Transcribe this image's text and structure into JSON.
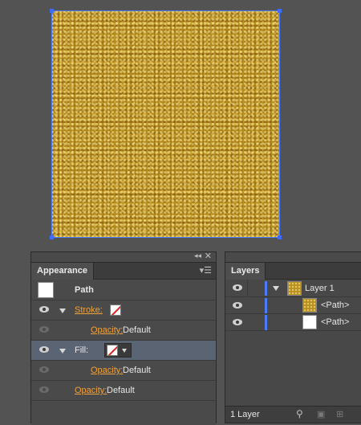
{
  "appearance": {
    "tab_label": "Appearance",
    "object_label": "Path",
    "stroke_label": "Stroke:",
    "fill_label": "Fill:",
    "opacity_label": "Opacity:",
    "opacity_value": "Default"
  },
  "layers": {
    "tab_label": "Layers",
    "layer_name": "Layer 1",
    "items": [
      {
        "label": "<Path>",
        "thumb": "gold"
      },
      {
        "label": "<Path>",
        "thumb": "white"
      }
    ],
    "footer_count": "1 Layer"
  },
  "colors": {
    "selection": "#3d6cff",
    "accent_orange": "#f0a23c",
    "layer_color_bar": "#4b7bff",
    "none_swatch_line": "#e02020"
  },
  "icons": [
    "eye-icon",
    "disclosure-triangle-icon",
    "panel-menu-icon",
    "collapse-icon",
    "close-icon",
    "search-icon",
    "new-layer-icon",
    "delete-icon"
  ]
}
